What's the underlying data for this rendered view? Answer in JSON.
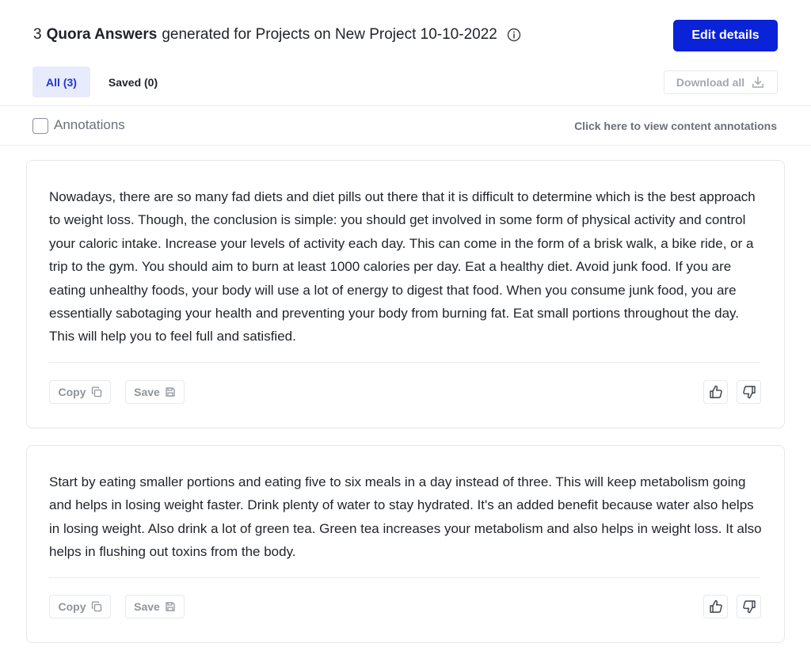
{
  "header": {
    "count": "3",
    "bold_title": "Quora Answers",
    "title_rest": "generated for Projects on New Project 10-10-2022",
    "edit_button": "Edit details"
  },
  "tabs": [
    {
      "label": "All (3)",
      "active": true
    },
    {
      "label": "Saved (0)",
      "active": false
    }
  ],
  "download_label": "Download all",
  "annotations": {
    "label": "Annotations",
    "checked": false,
    "link": "Click here to view content annotations"
  },
  "answers": [
    {
      "text": "Nowadays, there are so many fad diets and diet pills out there that it is difficult to determine which is the best approach to weight loss. Though, the conclusion is simple: you should get involved in some form of physical activity and control your caloric intake. Increase your levels of activity each day. This can come in the form of a brisk walk, a bike ride, or a trip to the gym. You should aim to burn at least 1000 calories per day. Eat a healthy diet. Avoid junk food. If you are eating unhealthy foods, your body will use a lot of energy to digest that food. When you consume junk food, you are essentially sabotaging your health and preventing your body from burning fat. Eat small portions throughout the day. This will help you to feel full and satisfied.",
      "copy_label": "Copy",
      "save_label": "Save"
    },
    {
      "text": "Start by eating smaller portions and eating five to six meals in a day instead of three. This will keep metabolism going and helps in losing weight faster. Drink plenty of water to stay hydrated. It's an added benefit because water also helps in losing weight. Also drink a lot of green tea. Green tea increases your metabolism and also helps in weight loss. It also helps in flushing out toxins from the body.",
      "copy_label": "Copy",
      "save_label": "Save"
    }
  ],
  "icons": {
    "info": "info-icon",
    "download": "download-icon",
    "copy": "copy-icon",
    "save": "floppy-disk-icon",
    "thumbs_up": "thumbs-up-icon",
    "thumbs_down": "thumbs-down-icon"
  },
  "colors": {
    "primary": "#0a22d8",
    "tab_active_bg": "#e8ebfb",
    "tab_active_text": "#1d35d6",
    "muted": "#8f949b",
    "border": "#e6e8eb"
  }
}
